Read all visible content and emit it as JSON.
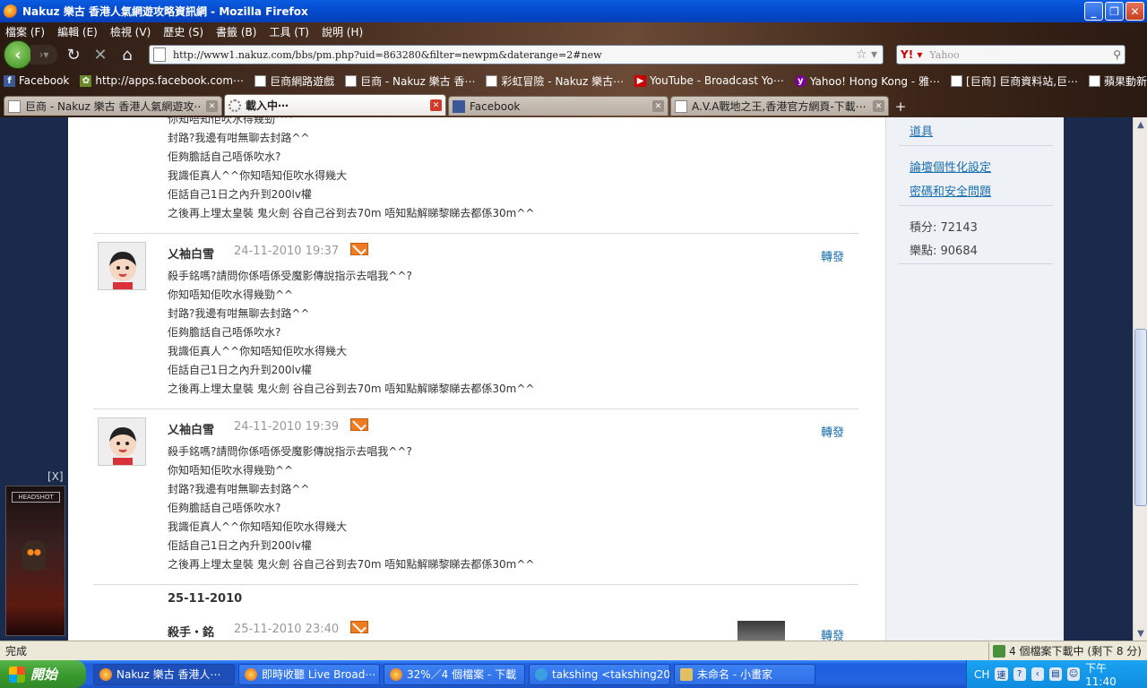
{
  "window": {
    "title": "Nakuz 樂古 香港人氣網遊攻略資訊網 - Mozilla Firefox"
  },
  "menu": [
    "檔案 (F)",
    "編輯 (E)",
    "檢視 (V)",
    "歷史 (S)",
    "書籤 (B)",
    "工具 (T)",
    "說明 (H)"
  ],
  "nav": {
    "url": "http://www1.nakuz.com/bbs/pm.php?uid=863280&filter=newpm&daterange=2#new",
    "search_placeholder": "Yahoo"
  },
  "bookmarks": [
    {
      "label": "Facebook",
      "icon": "facebook-icon"
    },
    {
      "label": "http://apps.facebook.com⋯",
      "icon": "apps-icon"
    },
    {
      "label": "巨商網路遊戲",
      "icon": "page-icon"
    },
    {
      "label": "巨商 - Nakuz 樂古 香⋯",
      "icon": "page-icon"
    },
    {
      "label": "彩虹冒險 - Nakuz 樂古⋯",
      "icon": "page-icon"
    },
    {
      "label": "YouTube - Broadcast Yo⋯",
      "icon": "youtube-icon"
    },
    {
      "label": "Yahoo! Hong Kong - 雅⋯",
      "icon": "yahoo-icon"
    },
    {
      "label": "[巨商] 巨商資料站,巨⋯",
      "icon": "page-icon"
    },
    {
      "label": "蘋果動新聞",
      "icon": "page-icon"
    }
  ],
  "tabs": [
    {
      "label": "巨商 - Nakuz 樂古 香港人氣網遊攻⋯",
      "icon": "page",
      "active": false
    },
    {
      "label": "載入中⋯",
      "icon": "spin",
      "active": true
    },
    {
      "label": "Facebook",
      "icon": "fb",
      "active": false
    },
    {
      "label": "A.V.A戰地之王,香港官方網頁-下載⋯",
      "icon": "page",
      "active": false
    }
  ],
  "sidebar": {
    "link_items": "道具",
    "link_forum_settings": "論壇個性化設定",
    "link_password": "密碼和安全問題",
    "points_label": "積分: 72143",
    "coins_label": "樂點: 90684"
  },
  "messages_top_fragment": {
    "lines": [
      "你知唔知佢吹水得幾勁^^",
      "封路?我邊有咁無聊去封路^^",
      "佢夠膽話自己唔係吹水?",
      "我識佢真人^^你知唔知佢吹水得幾大",
      "佢話自己1日之內升到200lv權",
      "之後再上埋太皇裝 鬼火劍 谷自己谷到去70m 唔知點解睇黎睇去都係30m^^"
    ]
  },
  "messages": [
    {
      "author": "乂袖白雪",
      "date": "24-11-2010 19:37",
      "forward": "轉發",
      "lines": [
        "殺手銘嗎?請問你係唔係受魔影傳說指示去唱我^^?",
        "你知唔知佢吹水得幾勁^^",
        "封路?我邊有咁無聊去封路^^",
        "佢夠膽話自己唔係吹水?",
        "我識佢真人^^你知唔知佢吹水得幾大",
        "佢話自己1日之內升到200lv權",
        "之後再上埋太皇裝 鬼火劍 谷自己谷到去70m 唔知點解睇黎睇去都係30m^^"
      ]
    },
    {
      "author": "乂袖白雪",
      "date": "24-11-2010 19:39",
      "forward": "轉發",
      "lines": [
        "殺手銘嗎?請問你係唔係受魔影傳說指示去唱我^^?",
        "你知唔知佢吹水得幾勁^^",
        "封路?我邊有咁無聊去封路^^",
        "佢夠膽話自己唔係吹水?",
        "我識佢真人^^你知唔知佢吹水得幾大",
        "佢話自己1日之內升到200lv權",
        "之後再上埋太皇裝 鬼火劍 谷自己谷到去70m 唔知點解睇黎睇去都係30m^^"
      ]
    }
  ],
  "date_group": "25-11-2010",
  "last_message": {
    "author": "殺手・銘",
    "date": "25-11-2010 23:40",
    "forward": "轉發"
  },
  "ad": {
    "close": "[X]",
    "brand": "HEADSHOT"
  },
  "status": {
    "text": "完成",
    "downloads": "4 個檔案下載中 (剩下 8 分)"
  },
  "taskbar": {
    "start": "開始",
    "tasks": [
      "Nakuz 樂古 香港人⋯",
      "即時收聽 Live Broad⋯",
      "32%／4 個檔案 - 下載",
      "takshing <takshing201⋯",
      "未命名 - 小畫家"
    ],
    "ime": "CH",
    "clock": "下午 11:40"
  },
  "colors": {
    "link": "#1a6faf",
    "page_bg": "#1a2a4d",
    "sidebar_bg": "#eef1f6"
  }
}
